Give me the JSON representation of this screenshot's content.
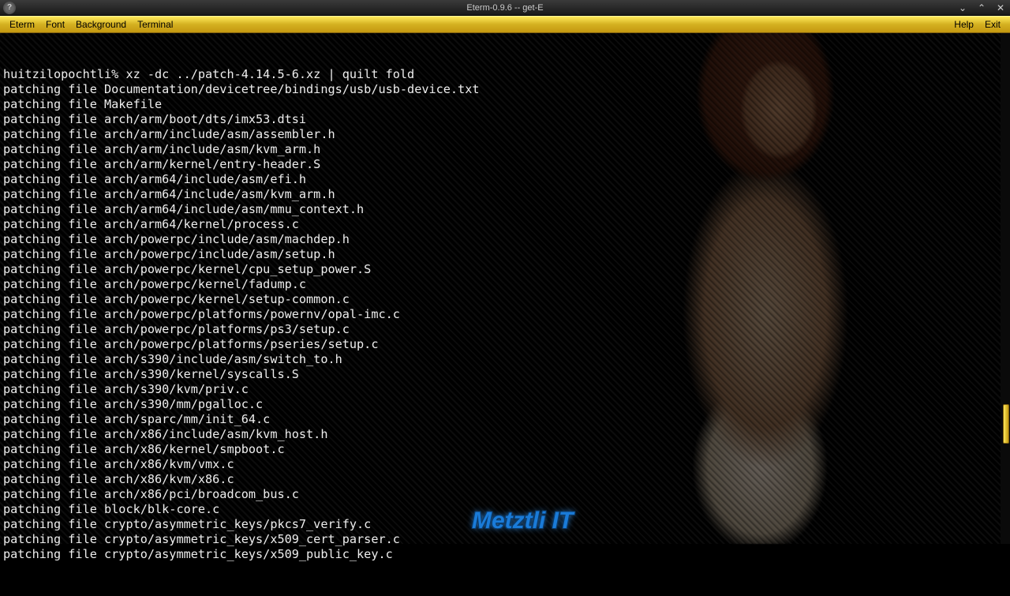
{
  "window": {
    "title": "Eterm-0.9.6 -- get-E",
    "icon_glyph": "?"
  },
  "titlebar_controls": {
    "minimize": "⌄",
    "maximize": "⌃",
    "close": "✕"
  },
  "menubar": {
    "left": [
      "Eterm",
      "Font",
      "Background",
      "Terminal"
    ],
    "right": [
      "Help",
      "Exit"
    ]
  },
  "terminal": {
    "prompt_line": "huitzilopochtli% xz -dc ../patch-4.14.5-6.xz | quilt fold",
    "lines": [
      "patching file Documentation/devicetree/bindings/usb/usb-device.txt",
      "patching file Makefile",
      "patching file arch/arm/boot/dts/imx53.dtsi",
      "patching file arch/arm/include/asm/assembler.h",
      "patching file arch/arm/include/asm/kvm_arm.h",
      "patching file arch/arm/kernel/entry-header.S",
      "patching file arch/arm64/include/asm/efi.h",
      "patching file arch/arm64/include/asm/kvm_arm.h",
      "patching file arch/arm64/include/asm/mmu_context.h",
      "patching file arch/arm64/kernel/process.c",
      "patching file arch/powerpc/include/asm/machdep.h",
      "patching file arch/powerpc/include/asm/setup.h",
      "patching file arch/powerpc/kernel/cpu_setup_power.S",
      "patching file arch/powerpc/kernel/fadump.c",
      "patching file arch/powerpc/kernel/setup-common.c",
      "patching file arch/powerpc/platforms/powernv/opal-imc.c",
      "patching file arch/powerpc/platforms/ps3/setup.c",
      "patching file arch/powerpc/platforms/pseries/setup.c",
      "patching file arch/s390/include/asm/switch_to.h",
      "patching file arch/s390/kernel/syscalls.S",
      "patching file arch/s390/kvm/priv.c",
      "patching file arch/s390/mm/pgalloc.c",
      "patching file arch/sparc/mm/init_64.c",
      "patching file arch/x86/include/asm/kvm_host.h",
      "patching file arch/x86/kernel/smpboot.c",
      "patching file arch/x86/kvm/vmx.c",
      "patching file arch/x86/kvm/x86.c",
      "patching file arch/x86/pci/broadcom_bus.c",
      "patching file block/blk-core.c",
      "patching file crypto/asymmetric_keys/pkcs7_verify.c",
      "patching file crypto/asymmetric_keys/x509_cert_parser.c",
      "patching file crypto/asymmetric_keys/x509_public_key.c"
    ]
  },
  "watermark": "Metztli IT"
}
